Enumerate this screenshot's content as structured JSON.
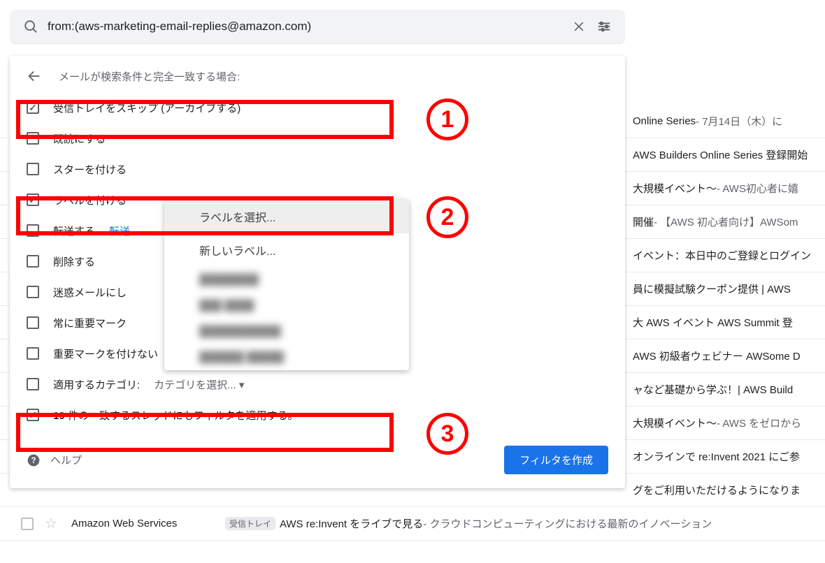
{
  "search": {
    "value": "from:(aws-marketing-email-replies@amazon.com)"
  },
  "panel": {
    "header": "メールが検索条件と完全一致する場合:",
    "options": {
      "skip_inbox": "受信トレイをスキップ (アーカイブする)",
      "mark_read": "既読にする",
      "star": "スターを付ける",
      "apply_label": "ラベルを付ける",
      "forward": "転送する",
      "forward_link": "転送",
      "delete": "削除する",
      "spam": "迷惑メールにし",
      "important": "常に重要マーク",
      "not_important": "重要マークを付けない",
      "category": "適用するカテゴリ:",
      "category_sub": "カテゴリを選択...",
      "also_apply_pre": "19",
      "also_apply_post": "件の一致するスレッドにもフィルタを適用する。"
    },
    "help": "ヘルプ",
    "create": "フィルタを作成"
  },
  "label_popup": {
    "select": "ラベルを選択...",
    "new": "新しいラベル...",
    "blurred": [
      "████████",
      "███ ████",
      "███████████",
      "██████ █████"
    ]
  },
  "emails": [
    {
      "subj": "Online Series",
      "prev": " - 7月14日（木）に"
    },
    {
      "subj": "AWS Builders Online Series 登録開始",
      "prev": ""
    },
    {
      "subj": "大規模イベント～",
      "prev": " - AWS初心者に嬉"
    },
    {
      "subj": "開催",
      "prev": " - 【AWS 初心者向け】AWSom"
    },
    {
      "subj": "イベント：本日中のご登録とログイン",
      "prev": ""
    },
    {
      "subj": "員に模擬試験クーポン提供 | AWS",
      "prev": ""
    },
    {
      "subj": "大 AWS イベント AWS Summit 登",
      "prev": ""
    },
    {
      "subj": "AWS 初級者ウェビナー AWSome D",
      "prev": ""
    },
    {
      "subj": "ャなど基礎から学ぶ！| AWS Build",
      "prev": ""
    },
    {
      "subj": "大規模イベント～",
      "prev": " - AWS をゼロから"
    },
    {
      "subj": "オンラインで re:Invent 2021 にご参",
      "prev": ""
    },
    {
      "subj": "グをご利用いただけるようになりま",
      "prev": ""
    }
  ],
  "full_row": {
    "sender": "Amazon Web Services",
    "badge": "受信トレイ",
    "subj": "AWS re:Invent をライブで見る",
    "prev": " - クラウドコンピューティングにおける最新のイノベーション"
  },
  "annotations": {
    "n1": "1",
    "n2": "2",
    "n3": "3"
  }
}
